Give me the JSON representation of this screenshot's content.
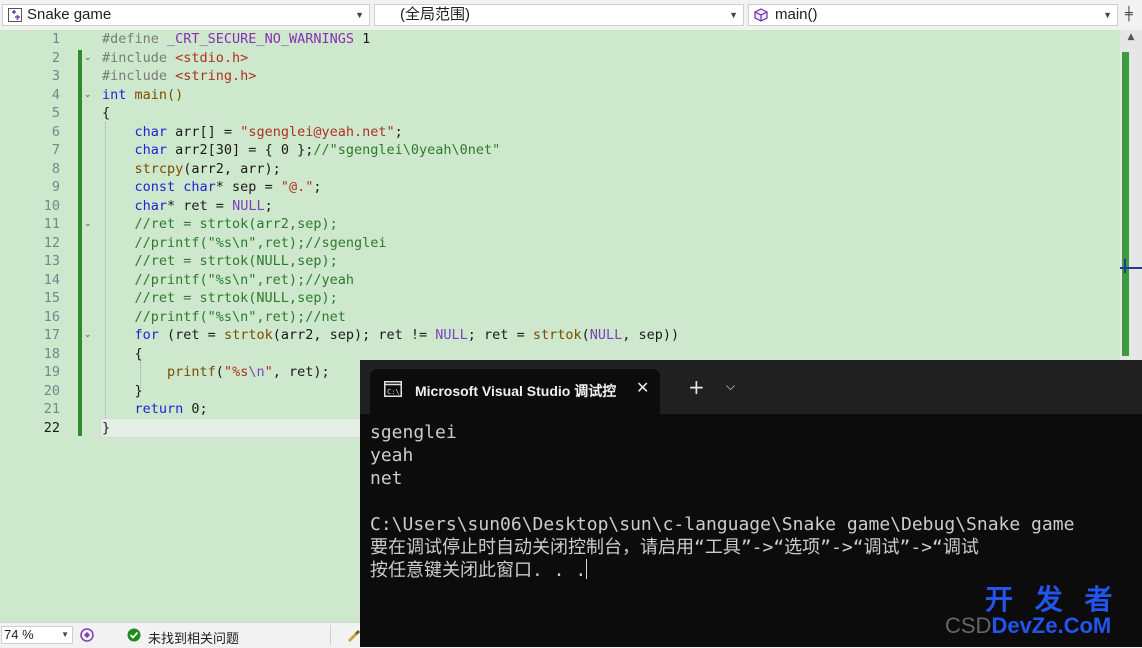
{
  "nav": {
    "project": "Snake game",
    "scope": "(全局范围)",
    "member": "main()"
  },
  "editor": {
    "lines": [
      {
        "n": "1"
      },
      {
        "n": "2"
      },
      {
        "n": "3"
      },
      {
        "n": "4"
      },
      {
        "n": "5"
      },
      {
        "n": "6"
      },
      {
        "n": "7"
      },
      {
        "n": "8"
      },
      {
        "n": "9"
      },
      {
        "n": "10"
      },
      {
        "n": "11"
      },
      {
        "n": "12"
      },
      {
        "n": "13"
      },
      {
        "n": "14"
      },
      {
        "n": "15"
      },
      {
        "n": "16"
      },
      {
        "n": "17"
      },
      {
        "n": "18"
      },
      {
        "n": "19"
      },
      {
        "n": "20"
      },
      {
        "n": "21"
      },
      {
        "n": "22"
      }
    ],
    "code": {
      "l1a": "#define ",
      "l1b": "_CRT_SECURE_NO_WARNINGS",
      "l1c": " 1",
      "l2a": "#include ",
      "l2b": "<stdio.h>",
      "l3a": "#include ",
      "l3b": "<string.h>",
      "l4a": "int",
      "l4b": " main()",
      "l5": "{",
      "l6a": "    char",
      "l6b": " arr[] = ",
      "l6c": "\"sgenglei@yeah.net\"",
      "l6d": ";",
      "l7a": "    char",
      "l7b": " arr2[30] = { 0 };",
      "l7c": "//\"sgenglei\\0yeah\\0net\"",
      "l8a": "    strcpy",
      "l8b": "(arr2, arr);",
      "l9a": "    const",
      "l9b": " char",
      "l9c": "* sep = ",
      "l9d": "\"@.\"",
      "l9e": ";",
      "l10a": "    char",
      "l10b": "* ret = ",
      "l10c": "NULL",
      "l10d": ";",
      "l11": "    //ret = strtok(arr2,sep);",
      "l12": "    //printf(\"%s\\n\",ret);//sgenglei",
      "l13": "    //ret = strtok(NULL,sep);",
      "l14": "    //printf(\"%s\\n\",ret);//yeah",
      "l15": "    //ret = strtok(NULL,sep);",
      "l16": "    //printf(\"%s\\n\",ret);//net",
      "l17a": "    for",
      "l17b": " (ret = ",
      "l17c": "strtok",
      "l17d": "(arr2, sep); ret != ",
      "l17e": "NULL",
      "l17f": "; ret = ",
      "l17g": "strtok",
      "l17h": "(",
      "l17i": "NULL",
      "l17j": ", sep))",
      "l18": "    {",
      "l19a": "        printf",
      "l19b": "(",
      "l19c": "\"%s",
      "l19d": "\\n",
      "l19e": "\"",
      "l19f": ", ret);",
      "l20": "    }",
      "l21a": "    return",
      "l21b": " 0;",
      "l22": "}"
    }
  },
  "status": {
    "zoom": "74 %",
    "issues": "未找到相关问题"
  },
  "console": {
    "tab_title": "Microsoft Visual Studio 调试控",
    "close": "✕",
    "new_tab": "+",
    "dropdown": "⌵",
    "out1": "sgenglei",
    "out2": "yeah",
    "out3": "net",
    "out4": "C:\\Users\\sun06\\Desktop\\sun\\c-language\\Snake game\\Debug\\Snake game",
    "out5": "要在调试停止时自动关闭控制台，请启用“工具”->“选项”->“调试”->“调试",
    "out6": "按任意键关闭此窗口. . ."
  },
  "watermark": {
    "line1": "开 发 者",
    "line2a": "CSD",
    "line2b": "DevZe.CoM"
  },
  "colors": {
    "editor_bg": "#cde8cd",
    "keyword": "#2222d6",
    "string": "#b0301f",
    "comment": "#2d7a2d",
    "console_bg": "#0c0c0c"
  }
}
